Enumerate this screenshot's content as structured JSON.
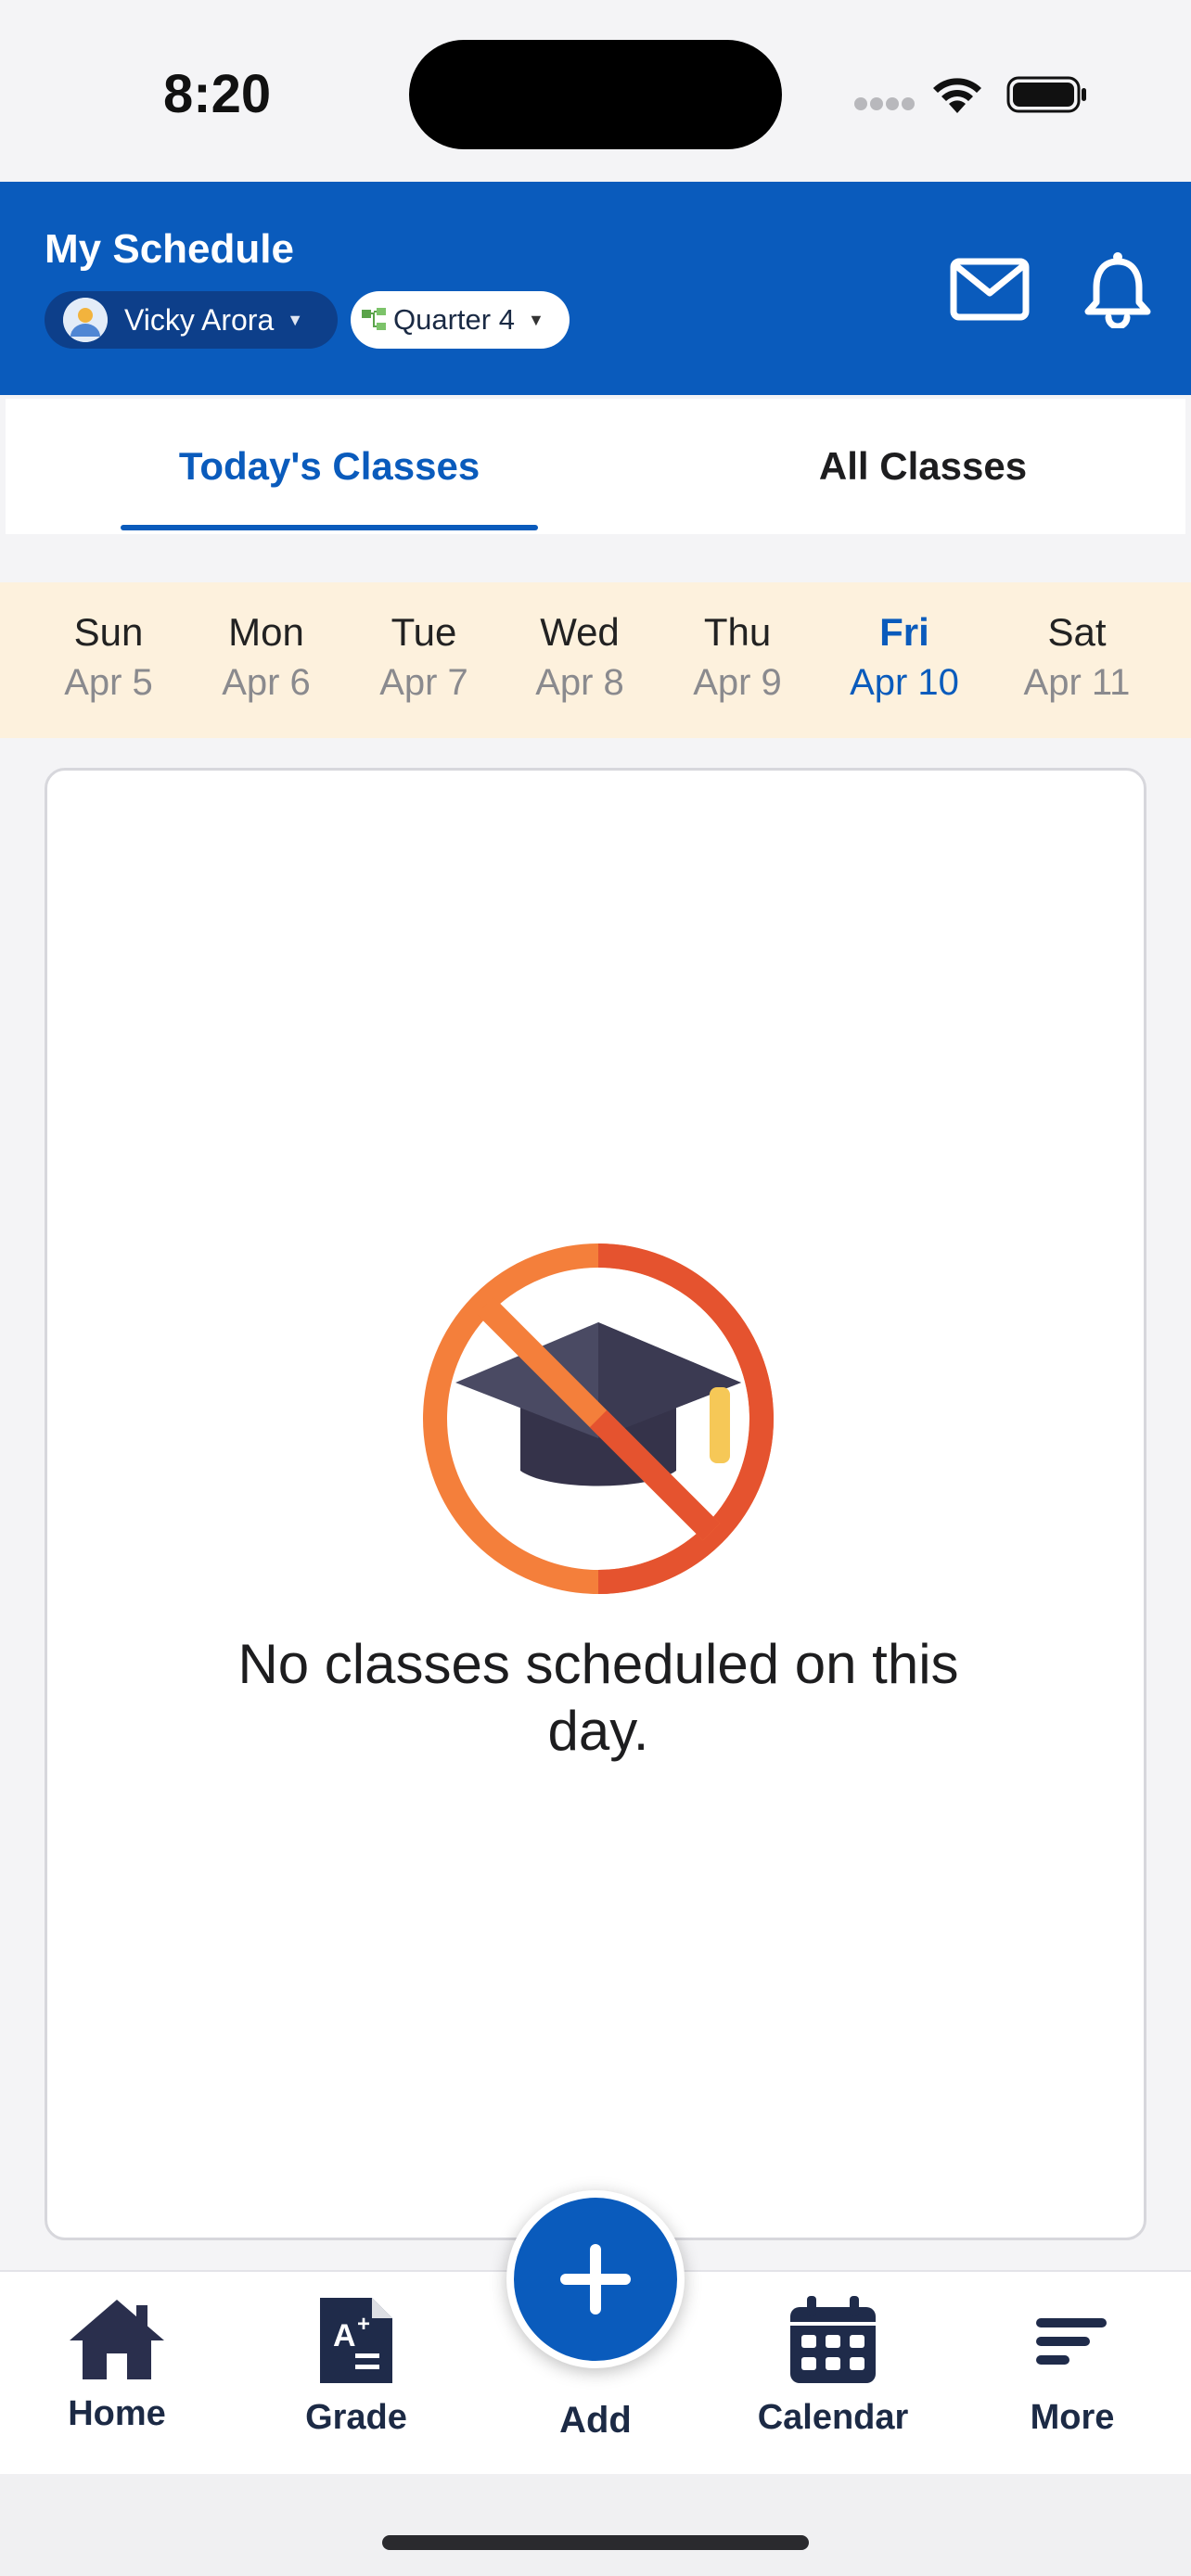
{
  "status_bar": {
    "time": "8:20"
  },
  "header": {
    "title": "My Schedule",
    "student_name": "Vicky Arora",
    "quarter": "Quarter 4",
    "accent_color": "#0a5bbc"
  },
  "tabs": [
    {
      "label": "Today's Classes",
      "active": true
    },
    {
      "label": "All Classes",
      "active": false
    }
  ],
  "week": [
    {
      "name": "Sun",
      "date": "Apr 5"
    },
    {
      "name": "Mon",
      "date": "Apr 6"
    },
    {
      "name": "Tue",
      "date": "Apr 7"
    },
    {
      "name": "Wed",
      "date": "Apr 8"
    },
    {
      "name": "Thu",
      "date": "Apr 9"
    },
    {
      "name": "Fri",
      "date": "Apr 10",
      "selected": true
    },
    {
      "name": "Sat",
      "date": "Apr 11"
    }
  ],
  "empty_state": {
    "icon": "no-classes-icon",
    "message": "No classes scheduled on this day."
  },
  "bottom_nav": {
    "home": "Home",
    "grade": "Grade",
    "add": "Add",
    "calendar": "Calendar",
    "more": "More"
  }
}
